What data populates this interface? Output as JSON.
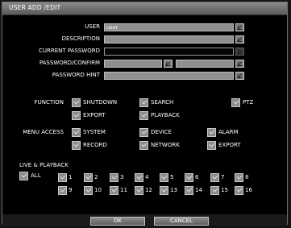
{
  "window": {
    "title": "USER ADD /EDIT"
  },
  "form": {
    "user": {
      "label": "USER",
      "value": "user"
    },
    "description": {
      "label": "DESCRIPTION",
      "value": ""
    },
    "current_password": {
      "label": "CURRENT PASSWORD",
      "value": ""
    },
    "password_confirm": {
      "label": "PASSWORD/CONFIRM",
      "value": ""
    },
    "password_hint": {
      "label": "PASSWORD HINT",
      "value": ""
    }
  },
  "function": {
    "label": "FUNCTION",
    "items": [
      "SHUTDOWN",
      "SEARCH",
      "PTZ",
      "EXPORT",
      "PLAYBACK"
    ]
  },
  "menu_access": {
    "label": "MENU ACCESS",
    "items": [
      "SYSTEM",
      "DEVICE",
      "ALARM",
      "RECORD",
      "NETWORK",
      "EXPORT"
    ]
  },
  "live_playback": {
    "label": "LIVE & PLAYBACK",
    "all": "ALL",
    "channels": [
      "1",
      "2",
      "3",
      "4",
      "5",
      "6",
      "7",
      "8",
      "9",
      "10",
      "11",
      "12",
      "13",
      "14",
      "15",
      "16"
    ]
  },
  "buttons": {
    "ok": "OK",
    "cancel": "CANCEL"
  }
}
